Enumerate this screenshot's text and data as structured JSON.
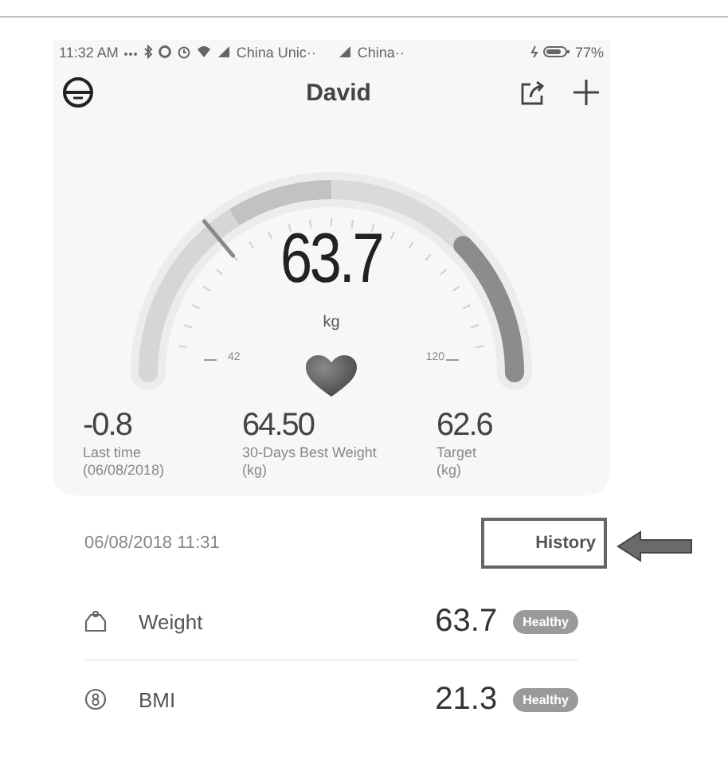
{
  "status_bar": {
    "time": "11:32 AM",
    "carriers": [
      "China Unic··",
      "China··"
    ],
    "battery": "77%"
  },
  "header": {
    "title": "David"
  },
  "gauge": {
    "value": "63.7",
    "unit": "kg",
    "min_label": "42",
    "max_label": "120"
  },
  "stats": [
    {
      "value": "-0.8",
      "label_lines": [
        "Last time",
        "(06/08/2018)"
      ]
    },
    {
      "value": "64.50",
      "label_lines": [
        "30-Days Best Weight",
        "(kg)"
      ]
    },
    {
      "value": "62.6",
      "label_lines": [
        "Target",
        "(kg)"
      ]
    }
  ],
  "measured_at": "06/08/2018 11:31",
  "history_button": {
    "label": "History",
    "highlighted": true
  },
  "metrics": [
    {
      "kind": "weight",
      "name": "Weight",
      "value": "63.7",
      "status": "Healthy"
    },
    {
      "kind": "bmi",
      "name": "BMI",
      "value": "21.3",
      "status": "Healthy"
    }
  ]
}
